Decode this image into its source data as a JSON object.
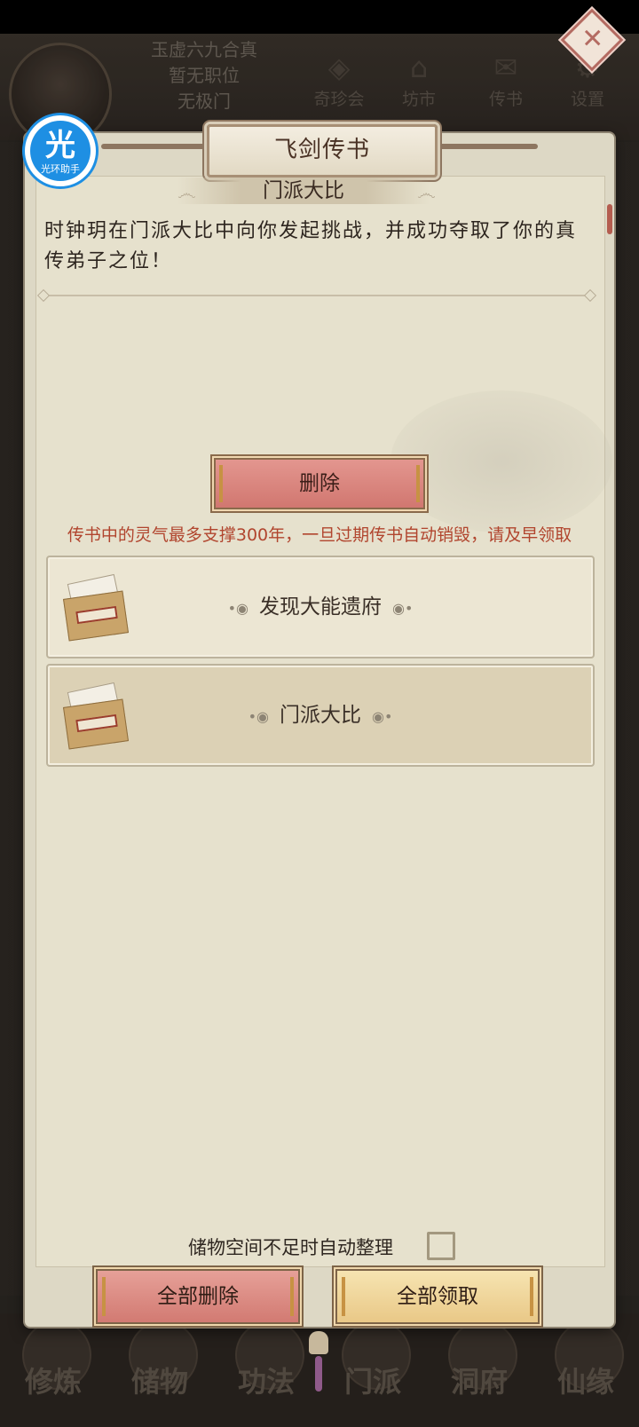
{
  "background": {
    "player": {
      "realm": "玉虚六九合真",
      "position": "暂无职位",
      "sect": "无极门"
    },
    "top_icons": [
      {
        "label": "奇珍会",
        "icon": "treasure-icon"
      },
      {
        "label": "坊市",
        "icon": "market-icon"
      },
      {
        "label": "传书",
        "icon": "scroll-icon"
      },
      {
        "label": "设置",
        "icon": "gear-icon"
      }
    ],
    "bottom_nav": [
      "修炼",
      "储物",
      "功法",
      "门派",
      "洞府",
      "仙缘"
    ]
  },
  "assistant_badge": {
    "char": "光",
    "label": "光环助手"
  },
  "dialog": {
    "title": "飞剑传书",
    "close_icon": "close-icon",
    "mail_subject": "门派大比",
    "mail_body": "时钟玥在门派大比中向你发起挑战，并成功夺取了你的真传弟子之位！",
    "delete_label": "删除",
    "warning": "传书中的灵气最多支撑300年，一旦过期传书自动销毁，请及早领取",
    "mails": [
      {
        "title": "发现大能遗府",
        "icon": "envelope-icon",
        "selected": false
      },
      {
        "title": "门派大比",
        "icon": "envelope-icon",
        "selected": true
      }
    ],
    "auto_sort_label": "储物空间不足时自动整理",
    "auto_sort_checked": false,
    "delete_all_label": "全部删除",
    "claim_all_label": "全部领取"
  },
  "colors": {
    "warning": "#b1452e",
    "delete_button": "#d17770",
    "claim_button": "#e9c887",
    "panel": "#e6e1cd"
  }
}
